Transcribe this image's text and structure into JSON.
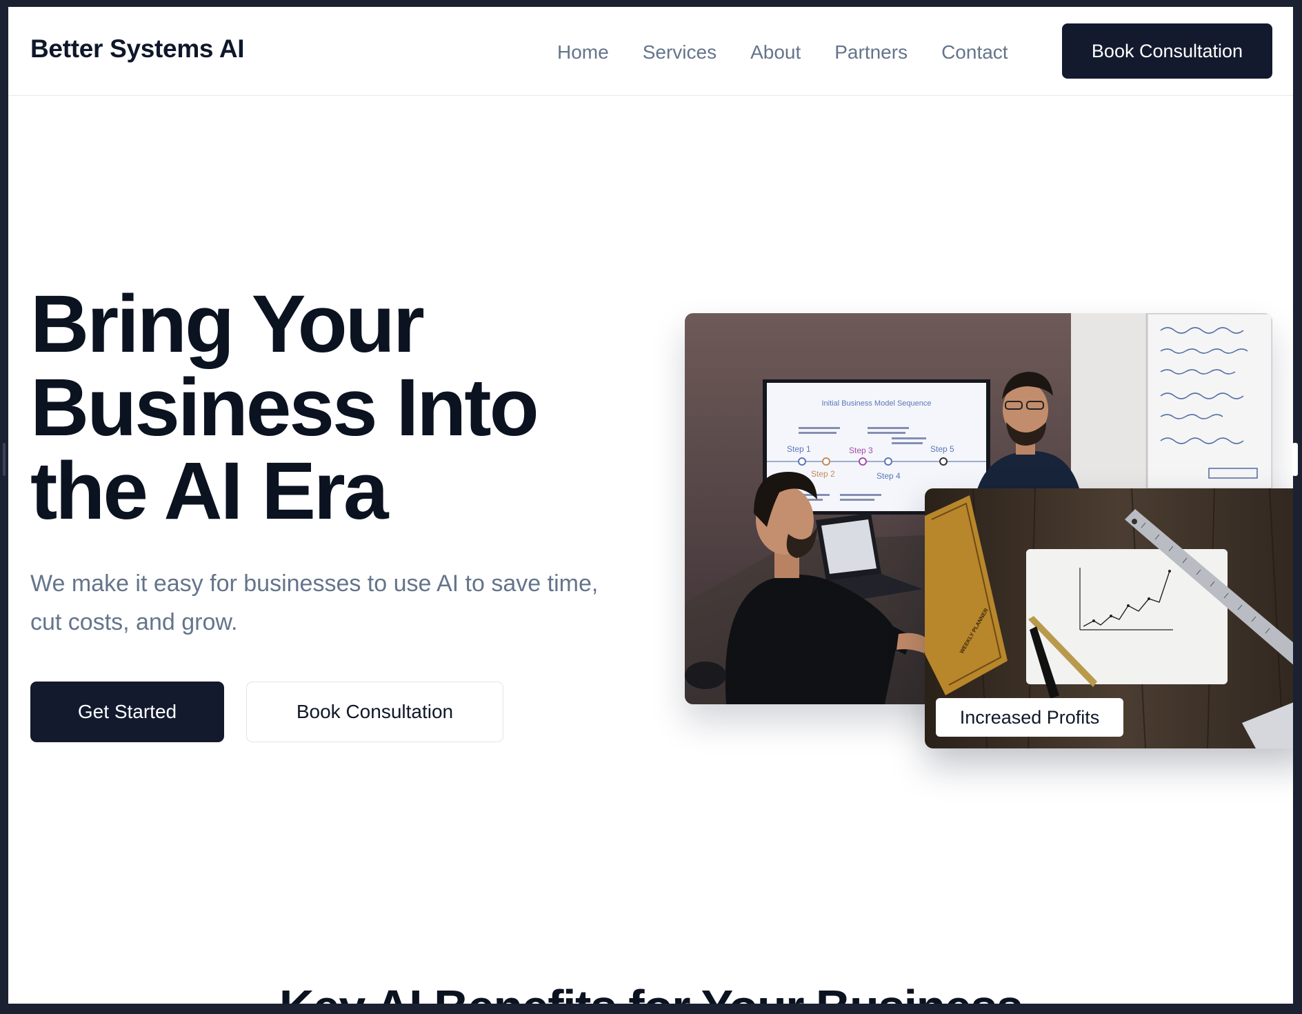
{
  "brand": {
    "name": "Better Systems AI"
  },
  "nav": {
    "items": [
      {
        "label": "Home"
      },
      {
        "label": "Services"
      },
      {
        "label": "About"
      },
      {
        "label": "Partners"
      },
      {
        "label": "Contact"
      }
    ],
    "cta_label": "Book Consultation"
  },
  "hero": {
    "title_lines": [
      "Bring Your",
      "Business Into",
      "the AI Era"
    ],
    "subtitle": "We make it easy for businesses to use AI to save time, cut costs, and grow.",
    "primary_button": "Get Started",
    "secondary_button": "Book Consultation"
  },
  "images": {
    "secondary_badge": "Increased Profits",
    "presentation_screen": {
      "title": "Initial Business Model Sequence",
      "steps": [
        "Step 1",
        "Step 2",
        "Step 3",
        "Step 4",
        "Step 5"
      ]
    },
    "planner_label": "WEEKLY PLANNER"
  },
  "next_section": {
    "heading": "Key AI Benefits for Your Business"
  },
  "colors": {
    "primary": "#131a2e",
    "text_dark": "#0b1220",
    "text_muted": "#64748b",
    "frame": "#1b2131"
  }
}
